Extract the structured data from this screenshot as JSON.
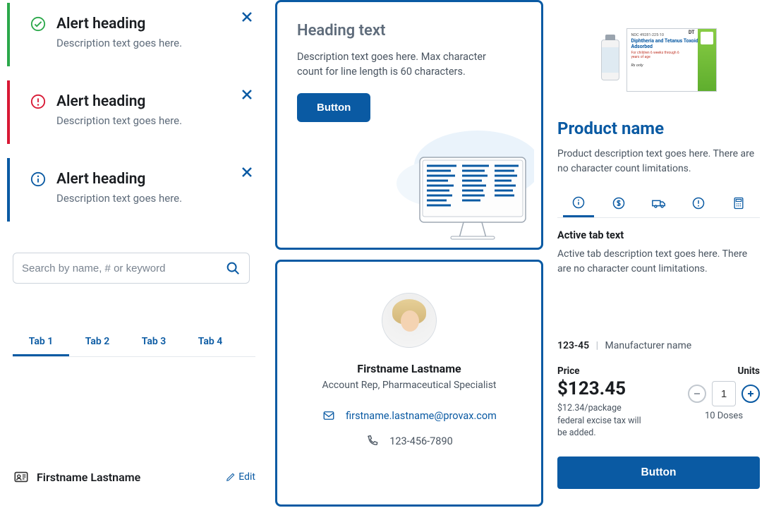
{
  "alerts": [
    {
      "heading": "Alert heading",
      "desc": "Description text goes here.",
      "type": "success"
    },
    {
      "heading": "Alert heading",
      "desc": "Description text goes here.",
      "type": "error"
    },
    {
      "heading": "Alert heading",
      "desc": "Description text goes here.",
      "type": "info"
    }
  ],
  "search": {
    "placeholder": "Search by name, # or keyword"
  },
  "tabs": [
    {
      "label": "Tab 1",
      "active": true
    },
    {
      "label": "Tab 2",
      "active": false
    },
    {
      "label": "Tab 3",
      "active": false
    },
    {
      "label": "Tab 4",
      "active": false
    }
  ],
  "user_row": {
    "name": "Firstname Lastname",
    "edit": "Edit"
  },
  "promo_card": {
    "heading": "Heading text",
    "desc": "Description text goes here. Max character count for line length is 60 characters.",
    "button": "Button"
  },
  "contact_card": {
    "name": "Firstname Lastname",
    "title": "Account Rep, Pharmaceutical Specialist",
    "email": "firstname.lastname@provax.com",
    "phone": "123-456-7890"
  },
  "product": {
    "box_ndc": "NDC 49281-225-10",
    "box_name": "Diphtheria and Tetanus Toxoids Adsorbed",
    "box_sub": "For children 6 weeks through 6 years of age",
    "box_rx": "Rx only",
    "box_badge": "DT",
    "name": "Product name",
    "desc": "Product description text goes here. There are no character count limitations.",
    "active_tab_title": "Active tab text",
    "active_tab_desc": "Active tab description text goes here. There are no character count limitations.",
    "sku": "123-45",
    "manufacturer": "Manufacturer name",
    "price_label": "Price",
    "price": "$123.45",
    "price_note": "$12.34/package federal excise tax will be added.",
    "units_label": "Units",
    "units_value": "1",
    "doses": "10 Doses",
    "action": "Button"
  }
}
